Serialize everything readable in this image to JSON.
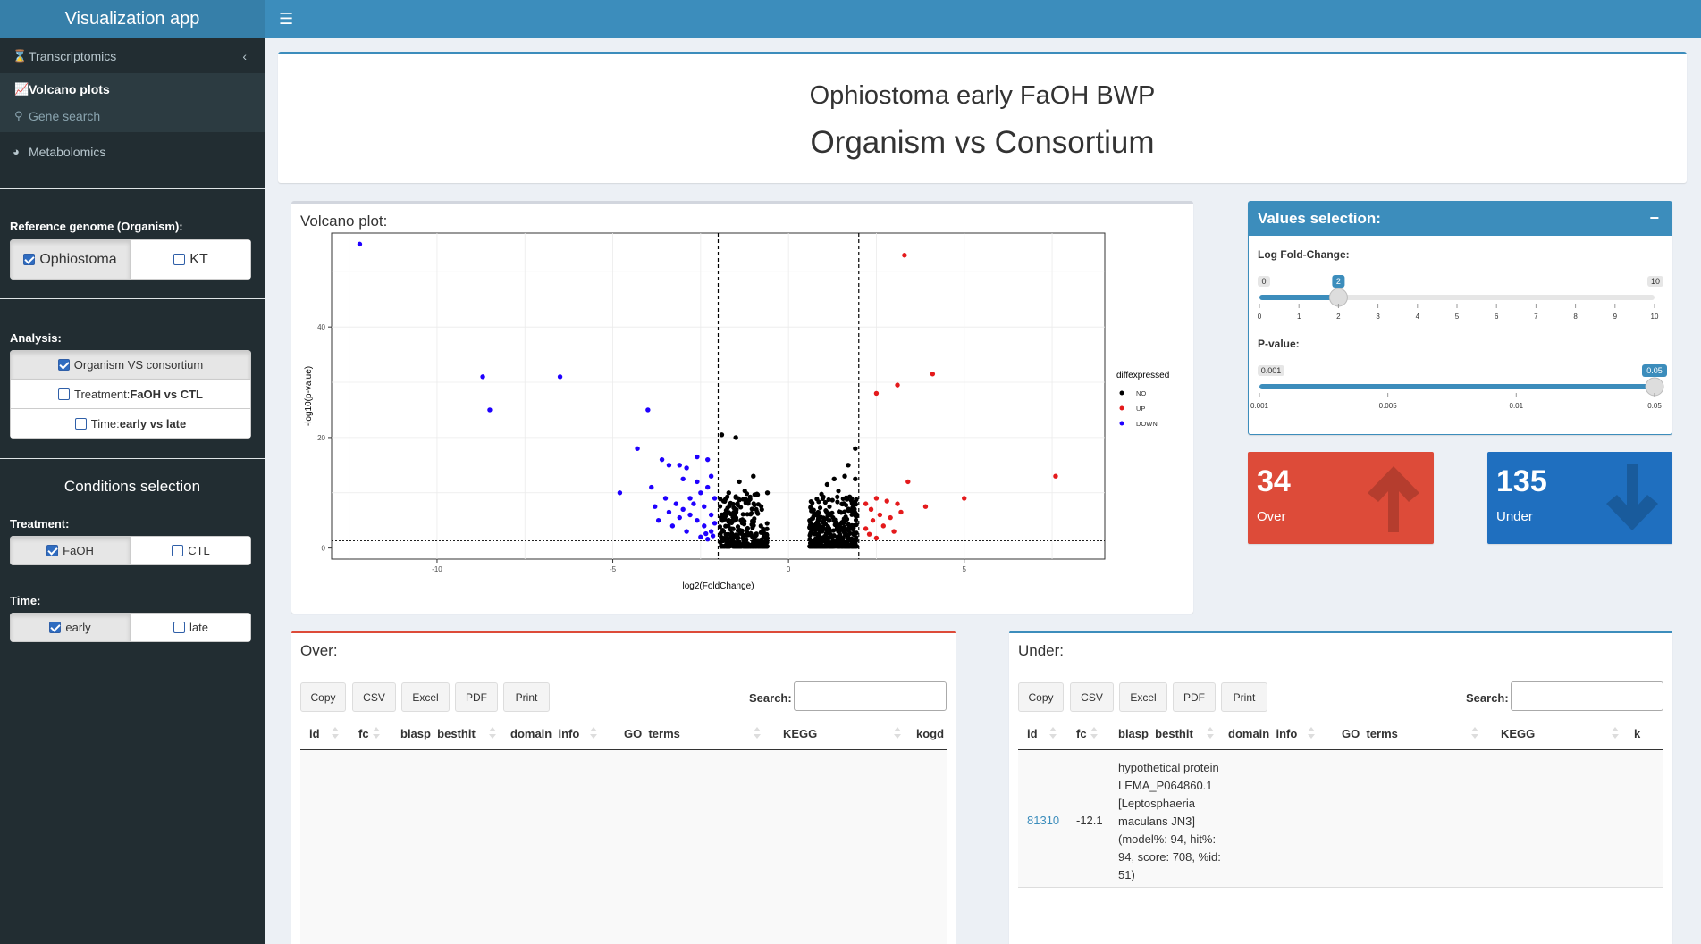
{
  "app": {
    "title": "Visualization app"
  },
  "sidebar": {
    "transcriptomics": "Transcriptomics",
    "volcano": "Volcano plots",
    "gene_search": "Gene search",
    "metabolomics": "Metabolomics",
    "ref_label": "Reference genome (Organism):",
    "ref_options": [
      "Ophiostoma",
      "KT"
    ],
    "analysis_label": "Analysis:",
    "analysis_options": [
      "Organism VS consortium",
      "Treatment: FaOH vs CTL",
      "Time: early vs late"
    ],
    "analysis_opt2_prefix": "Treatment: ",
    "analysis_opt2_bold": "FaOH vs CTL",
    "analysis_opt3_prefix": "Time: ",
    "analysis_opt3_bold": "early vs late",
    "conditions_title": "Conditions selection",
    "treatment_label": "Treatment:",
    "treatment_options": [
      "FaOH",
      "CTL"
    ],
    "time_label": "Time:",
    "time_options": [
      "early",
      "late"
    ]
  },
  "header": {
    "subtitle": "Ophiostoma early FaOH BWP",
    "title": "Organism vs Consortium"
  },
  "plot": {
    "box_title": "Volcano plot:"
  },
  "chart_data": {
    "type": "scatter",
    "xlabel": "log2(FoldChange)",
    "ylabel": "-log10(p-value)",
    "xlim": [
      -13,
      9
    ],
    "ylim": [
      -2,
      57
    ],
    "x_ticks": [
      "-10",
      "-5",
      "0",
      "5"
    ],
    "y_ticks": [
      "0",
      "20",
      "40"
    ],
    "thresholds": {
      "x": [
        -2,
        2
      ],
      "y": 1.3
    },
    "legend": {
      "title": "diffexpressed",
      "entries": [
        "NO",
        "UP",
        "DOWN"
      ],
      "position": "right"
    },
    "colors": {
      "NO": "#000000",
      "UP": "#e41a1c",
      "DOWN": "#1f00ff"
    },
    "series": [
      {
        "name": "DOWN",
        "points": [
          [
            -12.2,
            55
          ],
          [
            -8.7,
            31
          ],
          [
            -8.5,
            25
          ],
          [
            -6.5,
            31
          ],
          [
            -4,
            25
          ],
          [
            -4.3,
            18
          ],
          [
            -4.8,
            10
          ],
          [
            -3.6,
            16
          ],
          [
            -3.4,
            15
          ],
          [
            -3.1,
            15
          ],
          [
            -2.9,
            14.5
          ],
          [
            -2.6,
            16.5
          ],
          [
            -2.3,
            16
          ],
          [
            -3.9,
            11
          ],
          [
            -3.5,
            9
          ],
          [
            -3.2,
            8
          ],
          [
            -3,
            7
          ],
          [
            -2.8,
            6
          ],
          [
            -2.6,
            5
          ],
          [
            -2.4,
            4
          ],
          [
            -2.2,
            3
          ],
          [
            -3.7,
            5
          ],
          [
            -3.3,
            4
          ],
          [
            -2.9,
            3
          ],
          [
            -2.5,
            2
          ],
          [
            -2.3,
            1.6
          ],
          [
            -2.7,
            8
          ],
          [
            -2.5,
            10
          ],
          [
            -2.3,
            11
          ],
          [
            -2.1,
            9
          ],
          [
            -3.4,
            6.5
          ],
          [
            -3.8,
            7.5
          ],
          [
            -2.2,
            6
          ],
          [
            -2.4,
            7.5
          ],
          [
            -2.6,
            12
          ],
          [
            -3,
            12.5
          ],
          [
            -2.2,
            13
          ],
          [
            -2.1,
            4.5
          ],
          [
            -2.8,
            9
          ],
          [
            -3.1,
            5.5
          ],
          [
            -2.35,
            2.6
          ],
          [
            -2.15,
            2.2
          ]
        ]
      },
      {
        "name": "UP",
        "points": [
          [
            3.3,
            53
          ],
          [
            4.1,
            31.5
          ],
          [
            3.1,
            29.5
          ],
          [
            2.5,
            28
          ],
          [
            3.4,
            12
          ],
          [
            7.6,
            13
          ],
          [
            5,
            9
          ],
          [
            3.9,
            7.5
          ],
          [
            2.2,
            8
          ],
          [
            2.5,
            9
          ],
          [
            2.8,
            8.5
          ],
          [
            3.1,
            8
          ],
          [
            2.4,
            5
          ],
          [
            2.7,
            4
          ],
          [
            3,
            3
          ],
          [
            2.3,
            2.5
          ],
          [
            2.6,
            6
          ],
          [
            2.9,
            5.5
          ],
          [
            2.2,
            3.5
          ],
          [
            2.5,
            1.8
          ],
          [
            3.2,
            6.5
          ],
          [
            2.35,
            7
          ]
        ]
      },
      {
        "name": "NO",
        "points": [
          [
            -1.9,
            20.5
          ],
          [
            -1.5,
            20
          ],
          [
            1.9,
            18
          ],
          [
            1.9,
            12.5
          ],
          [
            1.3,
            12.5
          ],
          [
            1.1,
            11.5
          ],
          [
            1.6,
            13
          ],
          [
            1.7,
            15
          ],
          [
            -1,
            13
          ],
          [
            -0.6,
            10
          ],
          [
            -1.4,
            12
          ],
          [
            -1.7,
            10
          ]
        ]
      }
    ]
  },
  "values": {
    "title": "Values selection:",
    "logfc_label": "Log Fold-Change:",
    "logfc_min": "0",
    "logfc_max": "10",
    "logfc_value": "2",
    "logfc_value_num": 2,
    "logfc_ticks": [
      "0",
      "1",
      "2",
      "3",
      "4",
      "5",
      "6",
      "7",
      "8",
      "9",
      "10"
    ],
    "pvalue_label": "P-value:",
    "pvalue_min": "0.001",
    "pvalue_value": "0.05",
    "pvalue_ticks": [
      "0.001",
      "0.005",
      "0.01",
      "0.05"
    ],
    "over_count": "34",
    "over_label": "Over",
    "under_count": "135",
    "under_label": "Under"
  },
  "tables": {
    "buttons": [
      "Copy",
      "CSV",
      "Excel",
      "PDF",
      "Print"
    ],
    "search_label": "Search:",
    "over": {
      "title": "Over:",
      "columns": [
        "id",
        "fc",
        "blasp_besthit",
        "domain_info",
        "GO_terms",
        "KEGG",
        "kogd"
      ]
    },
    "under": {
      "title": "Under:",
      "columns": [
        "id",
        "fc",
        "blasp_besthit",
        "domain_info",
        "GO_terms",
        "KEGG",
        "k"
      ],
      "rows": [
        {
          "id": "81310",
          "fc": "-12.1",
          "blasp_lines": [
            "hypothetical protein",
            "LEMA_P064860.1",
            "[Leptosphaeria",
            "maculans JN3]",
            "(model%: 94, hit%:",
            "94, score: 708, %id:",
            "51)"
          ]
        }
      ]
    }
  }
}
